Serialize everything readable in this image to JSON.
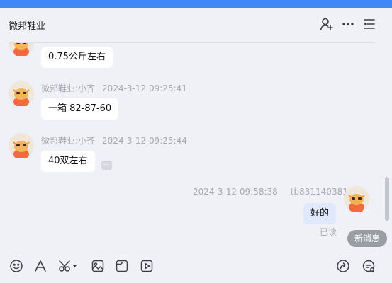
{
  "window": {
    "accent": "#3d88f6"
  },
  "header": {
    "title": "微邦鞋业",
    "icons": [
      "add-person-icon",
      "more-icon",
      "list-menu-icon"
    ]
  },
  "messages": [
    {
      "sender": "",
      "time": "",
      "text": "0.75公斤左右",
      "side": "left"
    },
    {
      "sender": "微邦鞋业:小齐",
      "time": "2024-3-12 09:25:41",
      "text": "一箱 82-87-60",
      "side": "left"
    },
    {
      "sender": "微邦鞋业:小齐",
      "time": "2024-3-12 09:25:44",
      "text": "40双左右",
      "side": "left"
    },
    {
      "sender": "tb831140381",
      "time": "2024-3-12 09:58:38",
      "text": "好的",
      "side": "right",
      "status": "已读"
    }
  ],
  "more_tag": "...",
  "new_message_button": "新消息",
  "toolbar": {
    "icons": [
      "emoji-icon",
      "font-icon",
      "scissors-icon",
      "image-icon",
      "file-icon",
      "video-icon",
      "share-icon",
      "chat-settings-icon"
    ]
  }
}
